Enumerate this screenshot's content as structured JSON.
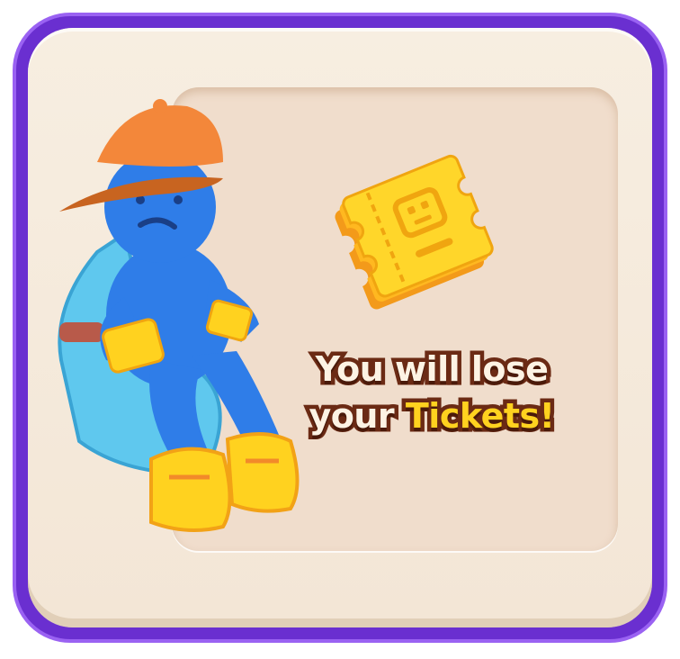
{
  "dialog": {
    "message_line1": "You will lose",
    "message_line2_prefix": "your ",
    "message_line2_highlight": "Tickets!"
  },
  "icons": {
    "tickets": "tickets-stack-icon",
    "character": "sad-blue-character-illustration"
  },
  "colors": {
    "frame": "#6a2fd0",
    "card": "#f5ebdd",
    "panel": "#f0ddcc",
    "text_fill": "#fdf3e4",
    "text_outline": "#6b2a14",
    "highlight": "#ffd21f"
  }
}
